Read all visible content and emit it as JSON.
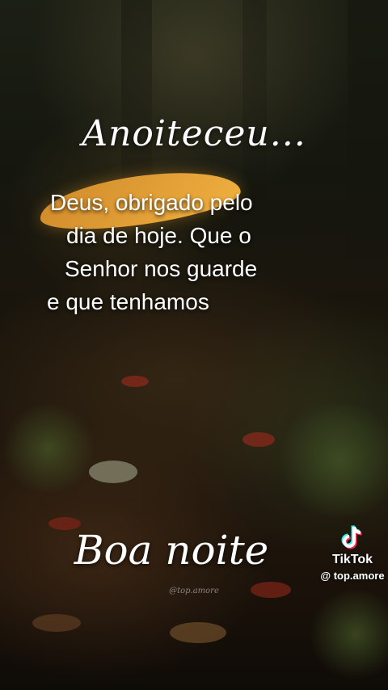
{
  "overlay": {
    "title": "Anoiteceu...",
    "message_lines": [
      "Deus, obrigado pelo",
      "dia de hoje. Que o",
      "Senhor nos guarde",
      "e que tenhamos"
    ],
    "greeting": "Boa noite",
    "watermark": "@top.amore"
  },
  "tiktok": {
    "icon": "tiktok-logo-icon",
    "brand": "TikTok",
    "handle": "@ top.amore"
  },
  "colors": {
    "text": "#ffffff",
    "leaf_accent": "#f0b040"
  }
}
